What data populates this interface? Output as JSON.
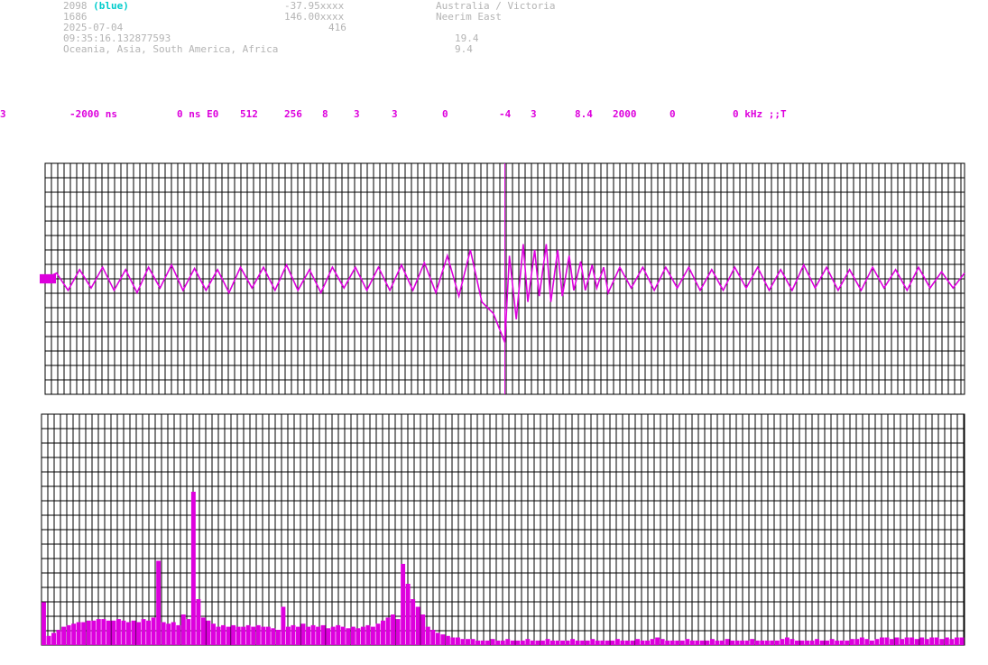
{
  "header": {
    "station_id": "2098",
    "station_tag": "(blue)",
    "station_num": "1686",
    "date": "2025-07-04",
    "time": "09:35:16.132877593",
    "regions": "Oceania, Asia, South America, Africa",
    "lat": "-37.95xxxx",
    "lon": "146.00xxxx",
    "alt": "416",
    "location_region": "Australia / Victoria",
    "location_place": "Neerim East",
    "val1": "19.4",
    "val2": "9.4"
  },
  "params": [
    "3",
    "-2000 ns",
    "0 ns E0",
    "512",
    "256",
    "8",
    "3",
    "3",
    "0",
    "-4",
    "3",
    "8.4",
    "2000",
    "0",
    "0 kHz ;;T"
  ],
  "colors": {
    "signal": "#dd00dd",
    "grid": "#000000",
    "header_text": "#b4b4b4",
    "header_highlight": "#00cccc"
  },
  "chart_data": [
    {
      "type": "line",
      "name": "waveform",
      "x_range_ns": [
        -2000,
        2000
      ],
      "ylim": [
        -1,
        1
      ],
      "grid": true,
      "marker_x_ns": 0,
      "x_ns": [
        -2000,
        -1950,
        -1900,
        -1850,
        -1800,
        -1750,
        -1700,
        -1650,
        -1600,
        -1550,
        -1500,
        -1450,
        -1400,
        -1350,
        -1300,
        -1250,
        -1200,
        -1150,
        -1100,
        -1050,
        -1000,
        -950,
        -900,
        -850,
        -800,
        -750,
        -700,
        -650,
        -600,
        -550,
        -500,
        -450,
        -400,
        -350,
        -300,
        -250,
        -200,
        -150,
        -100,
        -50,
        -20,
        0,
        20,
        50,
        80,
        100,
        130,
        150,
        180,
        200,
        230,
        250,
        280,
        300,
        330,
        350,
        380,
        400,
        430,
        450,
        500,
        550,
        600,
        650,
        700,
        750,
        800,
        850,
        900,
        950,
        1000,
        1050,
        1100,
        1150,
        1200,
        1250,
        1300,
        1350,
        1400,
        1450,
        1500,
        1550,
        1600,
        1650,
        1700,
        1750,
        1800,
        1850,
        1900,
        1950,
        2000
      ],
      "values": [
        0.0,
        0.05,
        -0.1,
        0.08,
        -0.08,
        0.1,
        -0.1,
        0.08,
        -0.12,
        0.1,
        -0.08,
        0.12,
        -0.1,
        0.09,
        -0.1,
        0.08,
        -0.12,
        0.1,
        -0.08,
        0.1,
        -0.1,
        0.12,
        -0.1,
        0.08,
        -0.12,
        0.1,
        -0.08,
        0.1,
        -0.1,
        0.1,
        -0.1,
        0.12,
        -0.1,
        0.14,
        -0.12,
        0.2,
        -0.15,
        0.25,
        -0.2,
        -0.3,
        -0.45,
        -0.55,
        0.2,
        -0.35,
        0.3,
        -0.2,
        0.25,
        -0.15,
        0.3,
        -0.2,
        0.25,
        -0.15,
        0.2,
        -0.1,
        0.15,
        -0.1,
        0.12,
        -0.08,
        0.1,
        -0.12,
        0.1,
        -0.08,
        0.1,
        -0.1,
        0.1,
        -0.08,
        0.1,
        -0.1,
        0.08,
        -0.1,
        0.1,
        -0.08,
        0.1,
        -0.1,
        0.08,
        -0.1,
        0.12,
        -0.08,
        0.1,
        -0.1,
        0.08,
        -0.1,
        0.1,
        -0.08,
        0.08,
        -0.1,
        0.1,
        -0.08,
        0.06,
        -0.08,
        0.05
      ]
    },
    {
      "type": "bar",
      "name": "spectrum",
      "x_range_khz": [
        0,
        2000
      ],
      "ylim": [
        0,
        1
      ],
      "grid": true,
      "values": [
        0.28,
        0.06,
        0.08,
        0.1,
        0.12,
        0.13,
        0.14,
        0.15,
        0.15,
        0.16,
        0.16,
        0.17,
        0.17,
        0.16,
        0.16,
        0.17,
        0.16,
        0.15,
        0.16,
        0.15,
        0.17,
        0.16,
        0.18,
        0.55,
        0.15,
        0.14,
        0.15,
        0.13,
        0.2,
        0.17,
        1.0,
        0.3,
        0.18,
        0.16,
        0.14,
        0.12,
        0.13,
        0.12,
        0.13,
        0.12,
        0.12,
        0.13,
        0.12,
        0.13,
        0.12,
        0.12,
        0.11,
        0.1,
        0.25,
        0.12,
        0.13,
        0.12,
        0.14,
        0.12,
        0.13,
        0.12,
        0.13,
        0.11,
        0.12,
        0.13,
        0.12,
        0.11,
        0.12,
        0.11,
        0.12,
        0.13,
        0.12,
        0.14,
        0.16,
        0.18,
        0.2,
        0.17,
        0.53,
        0.4,
        0.3,
        0.25,
        0.2,
        0.12,
        0.1,
        0.08,
        0.07,
        0.06,
        0.05,
        0.05,
        0.04,
        0.04,
        0.04,
        0.03,
        0.03,
        0.03,
        0.04,
        0.03,
        0.03,
        0.04,
        0.03,
        0.03,
        0.03,
        0.04,
        0.03,
        0.03,
        0.03,
        0.04,
        0.03,
        0.03,
        0.03,
        0.03,
        0.04,
        0.03,
        0.03,
        0.03,
        0.04,
        0.03,
        0.03,
        0.03,
        0.03,
        0.04,
        0.03,
        0.03,
        0.03,
        0.04,
        0.03,
        0.03,
        0.04,
        0.05,
        0.04,
        0.03,
        0.03,
        0.03,
        0.03,
        0.04,
        0.03,
        0.03,
        0.03,
        0.03,
        0.04,
        0.03,
        0.03,
        0.04,
        0.03,
        0.03,
        0.03,
        0.03,
        0.04,
        0.03,
        0.03,
        0.03,
        0.03,
        0.03,
        0.04,
        0.05,
        0.04,
        0.03,
        0.03,
        0.03,
        0.03,
        0.04,
        0.03,
        0.03,
        0.04,
        0.03,
        0.03,
        0.03,
        0.04,
        0.04,
        0.05,
        0.04,
        0.03,
        0.04,
        0.05,
        0.05,
        0.04,
        0.05,
        0.04,
        0.05,
        0.05,
        0.04,
        0.05,
        0.04,
        0.05,
        0.05,
        0.04,
        0.05,
        0.04,
        0.05,
        0.05
      ]
    }
  ]
}
